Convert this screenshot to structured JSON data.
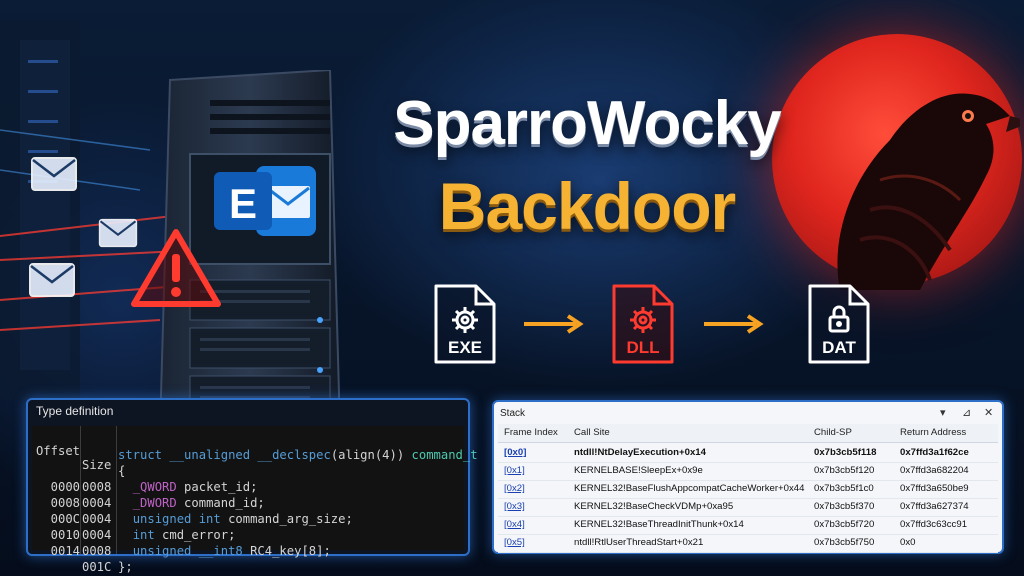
{
  "title": {
    "line1": "SparroWocky",
    "line2": "Backdoor"
  },
  "files": [
    {
      "label": "EXE",
      "color": "#ffffff"
    },
    {
      "label": "DLL",
      "color": "#ff3b30"
    },
    {
      "label": "DAT",
      "color": "#ffffff"
    }
  ],
  "server": {
    "logo_letter": "E"
  },
  "type_definition": {
    "header": "Type definition",
    "columns": [
      "Offset",
      "Size"
    ],
    "rows": [
      {
        "offset": "",
        "size": "",
        "code": [
          [
            "kw",
            "struct "
          ],
          [
            "kw",
            "__unaligned __declspec"
          ],
          [
            "cm",
            "(align(4)) "
          ],
          [
            "ty",
            "command_t"
          ]
        ]
      },
      {
        "offset": "",
        "size": "",
        "code": [
          [
            "cm",
            "{"
          ]
        ]
      },
      {
        "offset": "0000",
        "size": "0008",
        "code": [
          [
            "cm",
            "  "
          ],
          [
            "mac",
            "_QWORD"
          ],
          [
            "cm",
            " packet_id;"
          ]
        ]
      },
      {
        "offset": "0008",
        "size": "0004",
        "code": [
          [
            "cm",
            "  "
          ],
          [
            "mac",
            "_DWORD"
          ],
          [
            "cm",
            " command_id;"
          ]
        ]
      },
      {
        "offset": "000C",
        "size": "0004",
        "code": [
          [
            "cm",
            "  "
          ],
          [
            "kw",
            "unsigned int"
          ],
          [
            "cm",
            " command_arg_size;"
          ]
        ]
      },
      {
        "offset": "0010",
        "size": "0004",
        "code": [
          [
            "cm",
            "  "
          ],
          [
            "kw",
            "int"
          ],
          [
            "cm",
            " cmd_error;"
          ]
        ]
      },
      {
        "offset": "0014",
        "size": "0008",
        "code": [
          [
            "cm",
            "  "
          ],
          [
            "kw",
            "unsigned __int8"
          ],
          [
            "cm",
            " RC4_key[8];"
          ]
        ]
      },
      {
        "offset": "",
        "size": "001C",
        "code": [
          [
            "cm",
            "};"
          ]
        ]
      }
    ]
  },
  "stack": {
    "title": "Stack",
    "buttons": [
      "▾",
      "⊿",
      "✕"
    ],
    "columns": [
      "Frame Index",
      "Call Site",
      "Child-SP",
      "Return Address"
    ],
    "rows": [
      {
        "index": "[0x0]",
        "call_site": "ntdll!NtDelayExecution+0x14",
        "child_sp": "0x7b3cb5f118",
        "ret": "0x7ffd3a1f62ce",
        "bold": true
      },
      {
        "index": "[0x1]",
        "call_site": "KERNELBASE!SleepEx+0x9e",
        "child_sp": "0x7b3cb5f120",
        "ret": "0x7ffd3a682204",
        "bold": false
      },
      {
        "index": "[0x2]",
        "call_site": "KERNEL32!BaseFlushAppcompatCacheWorker+0x44",
        "child_sp": "0x7b3cb5f1c0",
        "ret": "0x7ffd3a650be9",
        "bold": false
      },
      {
        "index": "[0x3]",
        "call_site": "KERNEL32!BaseCheckVDMp+0xa95",
        "child_sp": "0x7b3cb5f370",
        "ret": "0x7ffd3a627374",
        "bold": false
      },
      {
        "index": "[0x4]",
        "call_site": "KERNEL32!BaseThreadInitThunk+0x14",
        "child_sp": "0x7b3cb5f720",
        "ret": "0x7ffd3c63cc91",
        "bold": false
      },
      {
        "index": "[0x5]",
        "call_site": "ntdll!RtlUserThreadStart+0x21",
        "child_sp": "0x7b3cb5f750",
        "ret": "0x0",
        "bold": false
      }
    ]
  },
  "colors": {
    "accent_blue": "#2d6ec8",
    "accent_orange": "#f6b232",
    "alert_red": "#ff3b30"
  },
  "icons": [
    "envelope-icon",
    "warning-icon",
    "gear-icon",
    "lock-icon",
    "arrow-right-icon",
    "sparrow-icon",
    "server-icon",
    "exchange-logo-icon"
  ]
}
